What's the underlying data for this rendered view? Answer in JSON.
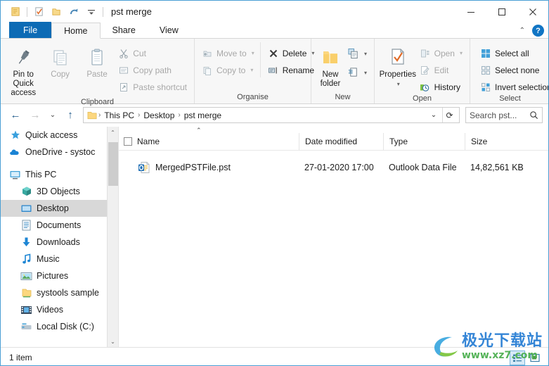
{
  "window": {
    "title": "pst merge",
    "minimize_label": "—",
    "maximize_label": "□",
    "close_label": "✕"
  },
  "quick_access_toolbar": {
    "items": [
      {
        "name": "folder-properties-icon",
        "tooltip": "Properties"
      },
      {
        "name": "checked-document-icon",
        "tooltip": "Properties"
      },
      {
        "name": "new-folder-icon",
        "tooltip": "New folder"
      },
      {
        "name": "redo-icon",
        "tooltip": "Redo"
      },
      {
        "name": "customize-dropdown-icon",
        "tooltip": "Customize Quick Access Toolbar"
      }
    ]
  },
  "tabs": [
    {
      "label": "File",
      "state": "file"
    },
    {
      "label": "Home",
      "state": "active"
    },
    {
      "label": "Share",
      "state": "normal"
    },
    {
      "label": "View",
      "state": "normal"
    }
  ],
  "tab_right": {
    "collapse_label": "⌃",
    "help_label": "?"
  },
  "ribbon": {
    "groups": [
      {
        "title": "Clipboard",
        "big_buttons": [
          {
            "label": "Pin to Quick\naccess",
            "line1": "Pin to Quick",
            "line2": "access",
            "icon": "pin-icon",
            "dim": false
          },
          {
            "label": "Copy",
            "line1": "Copy",
            "line2": "",
            "icon": "copy-icon",
            "dim": true
          },
          {
            "label": "Paste",
            "line1": "Paste",
            "line2": "",
            "icon": "paste-icon",
            "dim": true
          }
        ],
        "small_buttons": [
          {
            "label": "Cut",
            "icon": "scissors-icon",
            "dim": true
          },
          {
            "label": "Copy path",
            "icon": "copy-path-icon",
            "dim": true
          },
          {
            "label": "Paste shortcut",
            "icon": "paste-shortcut-icon",
            "dim": true
          }
        ]
      },
      {
        "title": "Organise",
        "small_buttons_a": [
          {
            "label": "Move to",
            "icon": "move-to-icon",
            "dim": true,
            "caret": true
          },
          {
            "label": "Copy to",
            "icon": "copy-to-icon",
            "dim": true,
            "caret": true
          }
        ],
        "small_buttons_b": [
          {
            "label": "Delete",
            "icon": "delete-x-icon",
            "dim": false,
            "caret": true
          },
          {
            "label": "Rename",
            "icon": "rename-icon",
            "dim": false,
            "caret": false
          }
        ]
      },
      {
        "title": "New",
        "big_buttons": [
          {
            "line1": "New",
            "line2": "folder",
            "icon": "new-folder-big-icon",
            "dim": false
          }
        ],
        "split_buttons": [
          {
            "icon": "new-item-icon",
            "caret": true
          },
          {
            "icon": "easy-access-icon",
            "caret": true
          }
        ]
      },
      {
        "title": "Open",
        "big_buttons": [
          {
            "line1": "Properties",
            "line2": "",
            "icon": "properties-icon",
            "dim": false,
            "caret": true
          }
        ],
        "small_buttons": [
          {
            "label": "Open",
            "icon": "open-icon",
            "dim": true,
            "caret": true
          },
          {
            "label": "Edit",
            "icon": "edit-icon",
            "dim": true,
            "caret": false
          },
          {
            "label": "History",
            "icon": "history-icon",
            "dim": false,
            "caret": false
          }
        ]
      },
      {
        "title": "Select",
        "small_buttons": [
          {
            "label": "Select all",
            "icon": "select-all-icon",
            "dim": false
          },
          {
            "label": "Select none",
            "icon": "select-none-icon",
            "dim": false
          },
          {
            "label": "Invert selection",
            "icon": "invert-selection-icon",
            "dim": false
          }
        ]
      }
    ]
  },
  "address_bar": {
    "back_label": "←",
    "forward_label": "→",
    "recent_label": "⌄",
    "up_label": "↑",
    "crumbs": [
      "This PC",
      "Desktop",
      "pst merge"
    ],
    "crumb_separator": "›",
    "dropdown_label": "⌄",
    "refresh_label": "⟳",
    "search_placeholder": "Search pst...",
    "search_value": "",
    "search_icon": "magnifier-icon"
  },
  "nav_pane": {
    "items": [
      {
        "label": "Quick access",
        "icon": "star-pin-icon",
        "level": 0,
        "selected": false
      },
      {
        "label": "OneDrive - systoc",
        "icon": "onedrive-cloud-icon",
        "level": 0,
        "selected": false
      },
      {
        "label": "This PC",
        "icon": "this-pc-icon",
        "level": 0,
        "selected": false
      },
      {
        "label": "3D Objects",
        "icon": "3d-objects-icon",
        "level": 1,
        "selected": false
      },
      {
        "label": "Desktop",
        "icon": "desktop-icon",
        "level": 1,
        "selected": true
      },
      {
        "label": "Documents",
        "icon": "documents-icon",
        "level": 1,
        "selected": false
      },
      {
        "label": "Downloads",
        "icon": "downloads-icon",
        "level": 1,
        "selected": false
      },
      {
        "label": "Music",
        "icon": "music-icon",
        "level": 1,
        "selected": false
      },
      {
        "label": "Pictures",
        "icon": "pictures-icon",
        "level": 1,
        "selected": false
      },
      {
        "label": "systools sample",
        "icon": "folder-icon",
        "level": 1,
        "selected": false
      },
      {
        "label": "Videos",
        "icon": "videos-icon",
        "level": 1,
        "selected": false
      },
      {
        "label": "Local Disk (C:)",
        "icon": "local-disk-icon",
        "level": 1,
        "selected": false
      }
    ],
    "scroll_up_label": "⌃",
    "scroll_down_label": "⌄"
  },
  "file_list": {
    "sort_indicator": "⌃",
    "columns": [
      {
        "key": "name",
        "label": "Name"
      },
      {
        "key": "date",
        "label": "Date modified"
      },
      {
        "key": "type",
        "label": "Type"
      },
      {
        "key": "size",
        "label": "Size"
      }
    ],
    "rows": [
      {
        "name": "MergedPSTFile.pst",
        "date": "27-01-2020 17:00",
        "type": "Outlook Data File",
        "size": "14,82,561 KB",
        "icon": "outlook-pst-file-icon"
      }
    ]
  },
  "status_bar": {
    "item_count": "1 item",
    "view_buttons": [
      {
        "name": "details-view-button",
        "active": true
      },
      {
        "name": "large-icons-view-button",
        "active": false
      }
    ]
  },
  "watermark": {
    "chinese": "极光下载站",
    "url": "www.xz7.com"
  },
  "colors": {
    "file_tab_blue": "#0d6bb5",
    "window_border": "#4a9fd4",
    "ribbon_bg": "#f7f7f7",
    "selection_gray": "#d8d8d8",
    "help_blue": "#1175c4",
    "watermark_blue": "#2a7fd4",
    "watermark_green": "#4caf50"
  }
}
